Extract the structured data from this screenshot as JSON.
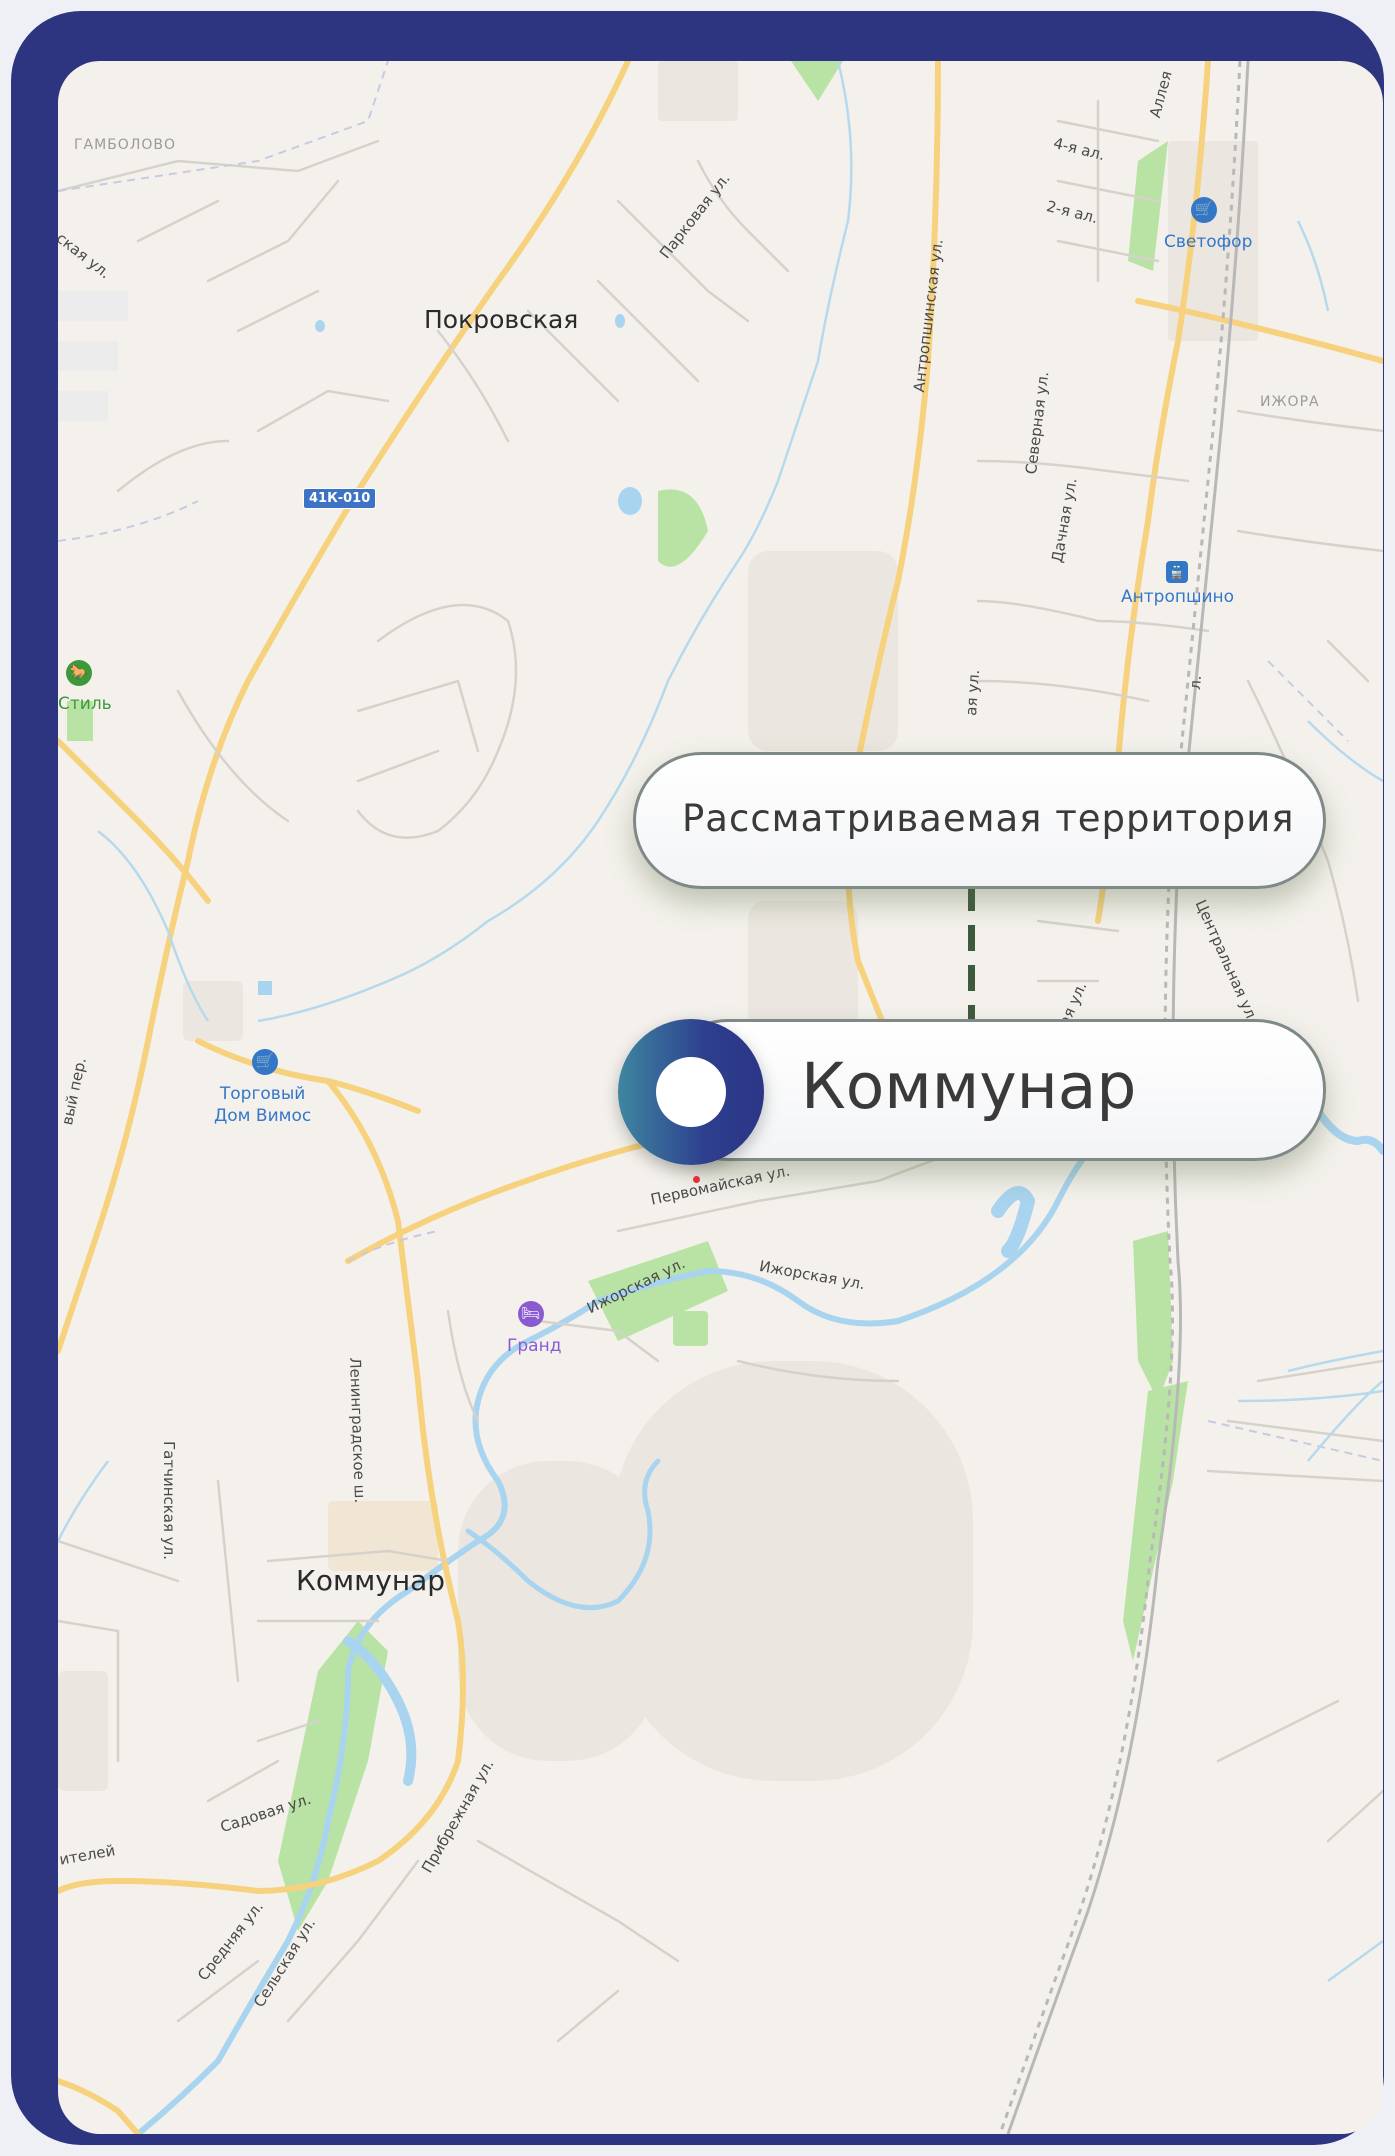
{
  "map": {
    "district_labels": [
      "ГАМБОЛОВО",
      "ИЖОРА"
    ],
    "town_labels": [
      "Покровская",
      "Коммунар"
    ],
    "road_shield": "41К-010",
    "streets": [
      "Парковая ул.",
      "Антропшинская ул.",
      "Северная ул.",
      "Дачная ул.",
      "Центральная ул.",
      "4-я ал.",
      "2-я ал.",
      "Аллея",
      "Первомайская ул.",
      "Ижорская ул.",
      "Ижорская ул.",
      "Ленинградское ш.",
      "Гатчинская ул.",
      "Садовая ул.",
      "Прибрежная ул.",
      "Средняя ул.",
      "Сельская ул.",
      "ская ул.",
      "ителей",
      "вый пер.",
      "ожная ул.",
      "ая ул.",
      "л."
    ],
    "pois": [
      {
        "name": "Светофор",
        "icon": "shopping-cart-icon",
        "color": "#3477c9"
      },
      {
        "name": "Антропшино",
        "icon": "train-station-icon",
        "color": "#3477c9"
      },
      {
        "name": "Стиль",
        "icon": "horse-riding-icon",
        "color": "#3a9a3a"
      },
      {
        "name": "Торговый\nДом Вимос",
        "icon": "shopping-cart-icon",
        "color": "#3477c9"
      },
      {
        "name": "Гранд",
        "icon": "hotel-bed-icon",
        "color": "#8a5bd0"
      }
    ]
  },
  "callouts": {
    "territory_label": "Рассматриваемая территория",
    "location_label": "Коммунар"
  },
  "colors": {
    "frame": "#2e3580",
    "water": "#a9d4ef",
    "park": "#b9e3a4",
    "road_major": "#f7d27e",
    "marker_gradient_start": "#3e86a0",
    "marker_gradient_end": "#2c3585",
    "connector": "#3d5a3c"
  }
}
